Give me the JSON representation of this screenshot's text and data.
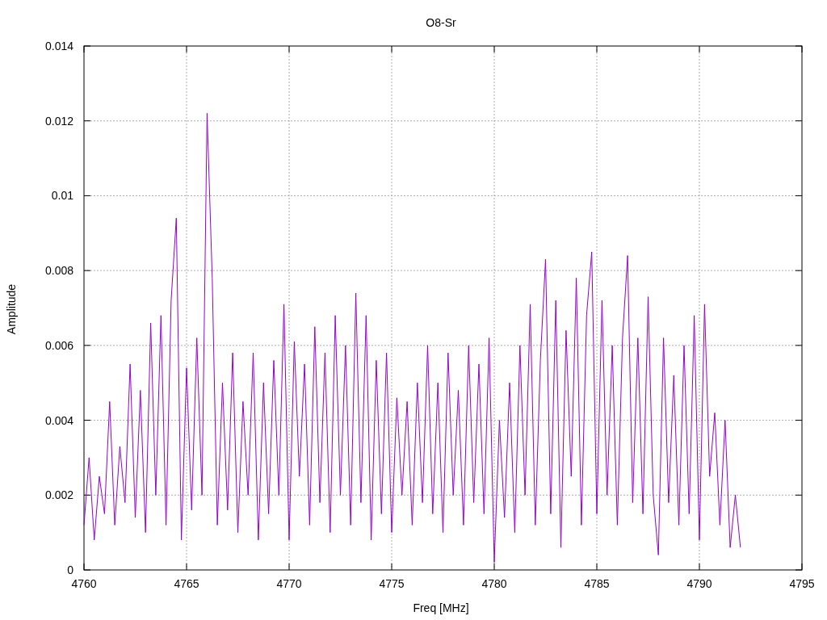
{
  "chart_data": {
    "type": "line",
    "title": "O8-Sr",
    "xlabel": "Freq [MHz]",
    "ylabel": "Amplitude",
    "grid": true,
    "xlim": [
      4760,
      4795
    ],
    "ylim": [
      0,
      0.014
    ],
    "xticks": [
      4760,
      4765,
      4770,
      4775,
      4780,
      4785,
      4790,
      4795
    ],
    "yticks": [
      {
        "value": 0,
        "label": "0"
      },
      {
        "value": 0.002,
        "label": "0.002"
      },
      {
        "value": 0.004,
        "label": "0.004"
      },
      {
        "value": 0.006,
        "label": "0.006"
      },
      {
        "value": 0.008,
        "label": "0.008"
      },
      {
        "value": 0.01,
        "label": "0.01"
      },
      {
        "value": 0.012,
        "label": "0.012"
      },
      {
        "value": 0.014,
        "label": "0.014"
      }
    ],
    "x": [
      4760,
      4760.25,
      4760.5,
      4760.75,
      4761,
      4761.25,
      4761.5,
      4761.75,
      4762,
      4762.25,
      4762.5,
      4762.75,
      4763,
      4763.25,
      4763.5,
      4763.75,
      4764,
      4764.25,
      4764.5,
      4764.75,
      4765,
      4765.25,
      4765.5,
      4765.75,
      4766,
      4766.25,
      4766.5,
      4766.75,
      4767,
      4767.25,
      4767.5,
      4767.75,
      4768,
      4768.25,
      4768.5,
      4768.75,
      4769,
      4769.25,
      4769.5,
      4769.75,
      4770,
      4770.25,
      4770.5,
      4770.75,
      4771,
      4771.25,
      4771.5,
      4771.75,
      4772,
      4772.25,
      4772.5,
      4772.75,
      4773,
      4773.25,
      4773.5,
      4773.75,
      4774,
      4774.25,
      4774.5,
      4774.75,
      4775,
      4775.25,
      4775.5,
      4775.75,
      4776,
      4776.25,
      4776.5,
      4776.75,
      4777,
      4777.25,
      4777.5,
      4777.75,
      4778,
      4778.25,
      4778.5,
      4778.75,
      4779,
      4779.25,
      4779.5,
      4779.75,
      4780,
      4780.25,
      4780.5,
      4780.75,
      4781,
      4781.25,
      4781.5,
      4781.75,
      4782,
      4782.25,
      4782.5,
      4782.75,
      4783,
      4783.25,
      4783.5,
      4783.75,
      4784,
      4784.25,
      4784.5,
      4784.75,
      4785,
      4785.25,
      4785.5,
      4785.75,
      4786,
      4786.25,
      4786.5,
      4786.75,
      4787,
      4787.25,
      4787.5,
      4787.75,
      4788,
      4788.25,
      4788.5,
      4788.75,
      4789,
      4789.25,
      4789.5,
      4789.75,
      4790,
      4790.25,
      4790.5,
      4790.75,
      4791,
      4791.25,
      4791.5,
      4791.75,
      4792
    ],
    "series": [
      {
        "color": "#9400d3",
        "values": [
          0.0012,
          0.003,
          0.0008,
          0.0025,
          0.0015,
          0.0045,
          0.0012,
          0.0033,
          0.0018,
          0.0055,
          0.0014,
          0.0048,
          0.001,
          0.0066,
          0.002,
          0.0068,
          0.0012,
          0.0072,
          0.0094,
          0.0008,
          0.0054,
          0.0016,
          0.0062,
          0.002,
          0.0122,
          0.0078,
          0.0012,
          0.005,
          0.0016,
          0.0058,
          0.001,
          0.0045,
          0.002,
          0.0058,
          0.0008,
          0.005,
          0.0015,
          0.0056,
          0.002,
          0.0071,
          0.0008,
          0.0061,
          0.0025,
          0.0055,
          0.0012,
          0.0065,
          0.0018,
          0.0058,
          0.001,
          0.0068,
          0.002,
          0.006,
          0.0012,
          0.0074,
          0.0018,
          0.0068,
          0.0008,
          0.0056,
          0.0015,
          0.0058,
          0.001,
          0.0046,
          0.002,
          0.0045,
          0.0012,
          0.005,
          0.0018,
          0.006,
          0.0015,
          0.005,
          0.001,
          0.0058,
          0.002,
          0.0048,
          0.0012,
          0.006,
          0.0018,
          0.0055,
          0.0015,
          0.0062,
          0.0002,
          0.004,
          0.0014,
          0.005,
          0.001,
          0.006,
          0.002,
          0.0071,
          0.0012,
          0.0056,
          0.0083,
          0.0015,
          0.0072,
          0.0006,
          0.0064,
          0.0025,
          0.0078,
          0.0012,
          0.0068,
          0.0085,
          0.0015,
          0.0072,
          0.002,
          0.006,
          0.0012,
          0.0062,
          0.0084,
          0.0018,
          0.0062,
          0.0015,
          0.0073,
          0.002,
          0.0004,
          0.0062,
          0.0018,
          0.0052,
          0.0012,
          0.006,
          0.0015,
          0.0068,
          0.0008,
          0.0071,
          0.0025,
          0.0042,
          0.0012,
          0.004,
          0.0006,
          0.002,
          0.0006
        ]
      }
    ]
  }
}
